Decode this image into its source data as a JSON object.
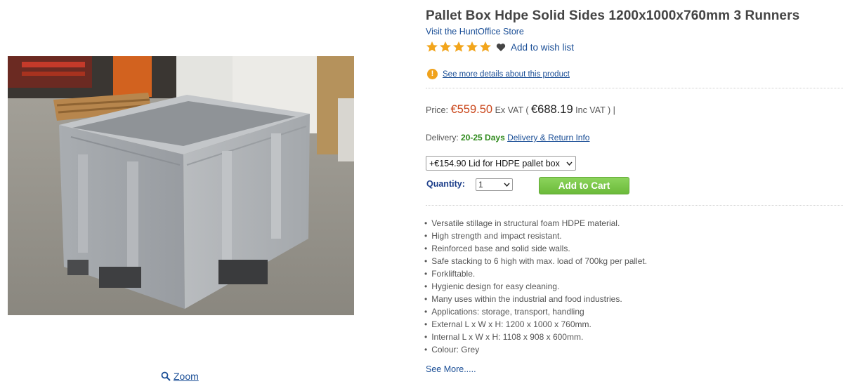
{
  "product": {
    "title": "Pallet Box Hdpe Solid Sides 1200x1000x760mm 3 Runners",
    "store_link": "Visit the HuntOffice Store",
    "rating_stars": 5,
    "wish_list_label": "Add to wish list",
    "details_link": "See more details about this product"
  },
  "pricing": {
    "price_label": "Price:",
    "price_ex": "€559.50",
    "ex_vat_label": "Ex VAT (",
    "price_inc": "€688.19",
    "inc_vat_label": "Inc VAT )"
  },
  "delivery": {
    "label": "Delivery:",
    "days": "20-25 Days",
    "link": "Delivery & Return Info"
  },
  "options": {
    "selected": "+€154.90 Lid for HDPE pallet box"
  },
  "quantity": {
    "label": "Quantity:",
    "selected": "1"
  },
  "cart": {
    "button_label": "Add to Cart"
  },
  "features": [
    "Versatile stillage in structural foam HDPE material.",
    "High strength and impact resistant.",
    "Reinforced base and solid side walls.",
    "Safe stacking to 6 high with max. load of 700kg per pallet.",
    "Forkliftable.",
    "Hygienic design for easy cleaning.",
    "Many uses within the industrial and food industries.",
    "Applications: storage, transport, handling",
    "External L x W x H: 1200 x 1000 x 760mm.",
    "Internal L x W x H: 1108 x 908 x 600mm.",
    "Colour: Grey"
  ],
  "see_more": "See More.....",
  "zoom_label": "Zoom",
  "colors": {
    "link": "#1a4e96",
    "price": "#c9461a",
    "delivery_days": "#2f8a1c",
    "cart_button": "#7cc74a",
    "star": "#f2a51c"
  },
  "icons": [
    "star-icon",
    "heart-icon",
    "info-icon",
    "chevron-down-icon",
    "magnifier-icon"
  ]
}
